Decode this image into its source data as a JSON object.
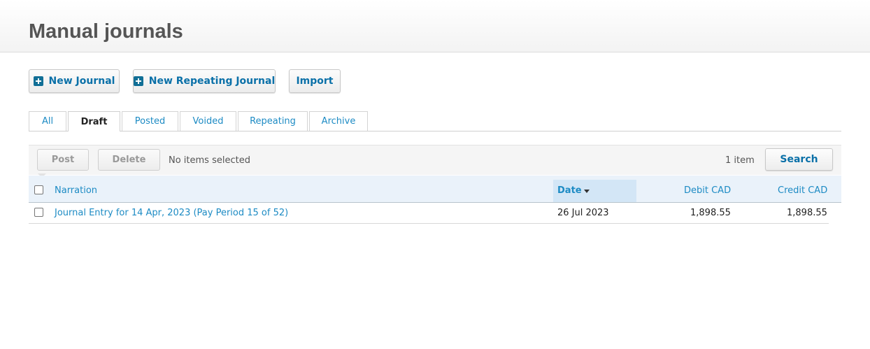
{
  "page": {
    "title": "Manual journals"
  },
  "actions": {
    "new_journal": "New Journal",
    "new_repeating_journal": "New Repeating Journal",
    "import": "Import"
  },
  "tabs": [
    {
      "label": "All"
    },
    {
      "label": "Draft",
      "active": true
    },
    {
      "label": "Posted"
    },
    {
      "label": "Voided"
    },
    {
      "label": "Repeating"
    },
    {
      "label": "Archive"
    }
  ],
  "toolbar": {
    "post_label": "Post",
    "delete_label": "Delete",
    "selection_status": "No items selected",
    "item_count": "1 item",
    "search_label": "Search"
  },
  "table": {
    "columns": {
      "narration": "Narration",
      "date": "Date",
      "debit": "Debit CAD",
      "credit": "Credit CAD"
    },
    "sort": {
      "column": "Date",
      "direction": "descending"
    },
    "rows": [
      {
        "narration": "Journal Entry for 14 Apr, 2023 (Pay Period 15 of 52)",
        "date": "26 Jul 2023",
        "debit": "1,898.55",
        "credit": "1,898.55",
        "checked": false
      }
    ]
  },
  "colors": {
    "accent": "#1d8bc4",
    "button_text": "#0a70a8",
    "plus_icon": "#116f96",
    "header_row": "#eaf2fa",
    "sorted_column": "#d3e6f6"
  }
}
